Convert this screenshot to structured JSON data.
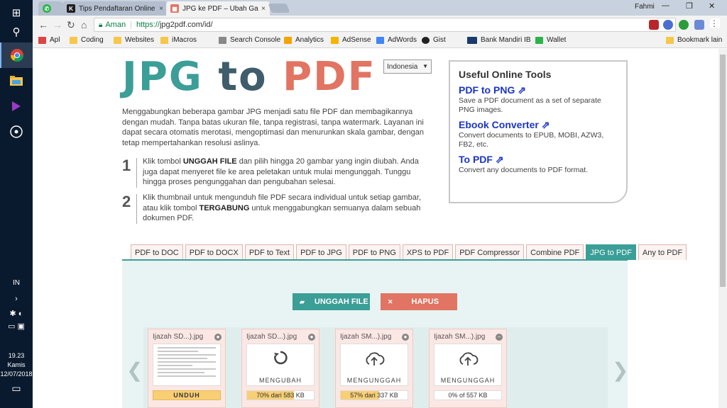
{
  "taskbar": {
    "lang": "IN",
    "time": "19.23",
    "day": "Kamis",
    "date": "12/07/2018"
  },
  "browser": {
    "tabs": [
      {
        "title": "",
        "favicon_color": "#2bb34a"
      },
      {
        "title": "Tips Pendaftaran Online «",
        "favicon_color": "#1e1e1e"
      },
      {
        "title": "JPG ke PDF – Ubah Gamb",
        "favicon_color": "#e17463"
      }
    ],
    "user": "Fahmi",
    "secure_label": "Aman",
    "url_scheme": "https://",
    "url_rest": "jpg2pdf.com/id/",
    "bookmarks": [
      "Apl",
      "Coding",
      "Websites",
      "iMacros",
      "Search Console",
      "Analytics",
      "AdSense",
      "AdWords",
      "Gist",
      "Bank Mandiri IB",
      "Wallet"
    ],
    "bookmarks_other": "Bookmark lain"
  },
  "page": {
    "logo": {
      "part1": "JPG",
      "part2": "to",
      "part3": "PDF"
    },
    "language": "Indonesia",
    "intro": "Menggabungkan beberapa gambar JPG menjadi satu file PDF dan membagikannya dengan mudah. Tanpa batas ukuran file, tanpa registrasi, tanpa watermark. Layanan ini dapat secara otomatis merotasi, mengoptimasi dan menurunkan skala gambar, dengan tetap mempertahankan resolusi aslinya.",
    "steps": [
      {
        "num": "1",
        "pre": "Klik tombol ",
        "bold": "UNGGAH FILE",
        "post": " dan pilih hingga 20 gambar yang ingin diubah. Anda juga dapat menyeret file ke area peletakan untuk mulai mengunggah. Tunggu hingga proses pengunggahan dan pengubahan selesai."
      },
      {
        "num": "2",
        "pre": "Klik thumbnail untuk mengunduh file PDF secara individual untuk setiap gambar, atau klik tombol ",
        "bold": "TERGABUNG",
        "post": " untuk menggabungkan semuanya dalam sebuah dokumen PDF."
      }
    ],
    "tools": {
      "title": "Useful Online Tools",
      "items": [
        {
          "name": "PDF to PNG",
          "desc": "Save a PDF document as a set of separate PNG images."
        },
        {
          "name": "Ebook Converter",
          "desc": "Convert documents to EPUB, MOBI, AZW3, FB2, etc."
        },
        {
          "name": "To PDF",
          "desc": "Convert any documents to PDF format."
        }
      ]
    },
    "conv_tabs": [
      "PDF to DOC",
      "PDF to DOCX",
      "PDF to Text",
      "PDF to JPG",
      "PDF to PNG",
      "XPS to PDF",
      "PDF Compressor",
      "Combine PDF",
      "JPG to PDF",
      "Any to PDF"
    ],
    "active_tab": "JPG to PDF",
    "upload_label": "UNGGAH FILE",
    "clear_label": "HAPUS",
    "files": [
      {
        "name": "Ijazah SD...).jpg",
        "status": "",
        "bar_text": "UNDUH",
        "progress": 1.0,
        "done": true
      },
      {
        "name": "Ijazah SD...).jpg",
        "status": "MENGUBAH",
        "bar_text": "70% dari 583 KB",
        "progress": 0.7,
        "done": false
      },
      {
        "name": "Ijazah SM...).jpg",
        "status": "MENGUNGGAH",
        "bar_text": "57% dari 337 KB",
        "progress": 0.57,
        "done": false
      },
      {
        "name": "Ijazah SM...).jpg",
        "status": "MENGUNGGAH",
        "bar_text": "0% of 557 KB",
        "progress": 0.0,
        "done": false
      }
    ],
    "colors": {
      "teal": "#3b9e97",
      "slate": "#3f5d6b",
      "salmon": "#e17463",
      "link": "#1a35c7"
    }
  }
}
